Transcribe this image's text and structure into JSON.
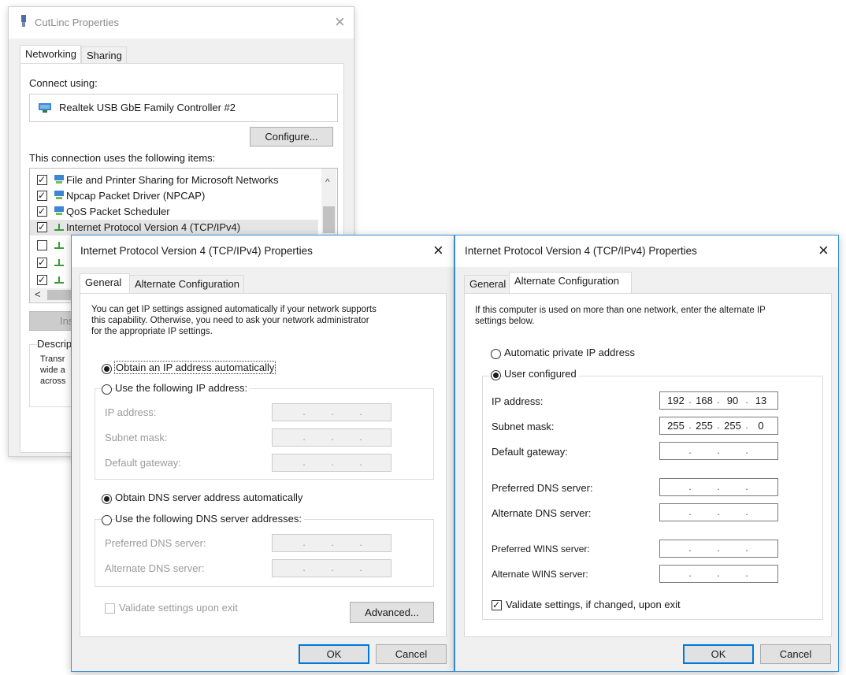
{
  "props": {
    "title": "CutLinc  Properties",
    "tabs": [
      "Networking",
      "Sharing"
    ],
    "connect_using_label": "Connect using:",
    "adapter": "Realtek USB GbE Family Controller #2",
    "configure_label": "Configure...",
    "items_label": "This connection uses the following items:",
    "items": [
      {
        "label": "File and Printer Sharing for Microsoft Networks",
        "checked": true,
        "icon": "network-service-icon"
      },
      {
        "label": "Npcap Packet Driver (NPCAP)",
        "checked": true,
        "icon": "network-service-icon"
      },
      {
        "label": "QoS Packet Scheduler",
        "checked": true,
        "icon": "network-service-icon"
      },
      {
        "label": "Internet Protocol Version 4 (TCP/IPv4)",
        "checked": true,
        "icon": "protocol-icon"
      },
      {
        "label": "",
        "checked": false,
        "icon": "protocol-icon"
      },
      {
        "label": "",
        "checked": true,
        "icon": "protocol-icon"
      },
      {
        "label": "",
        "checked": true,
        "icon": "protocol-icon"
      }
    ],
    "install_fragment": "Ins",
    "description_fragment": "Descrip",
    "desc_lines": [
      "Transr",
      "wide a",
      "across"
    ],
    "scroll_left_glyph": "<"
  },
  "general": {
    "title": "Internet Protocol Version 4 (TCP/IPv4) Properties",
    "tabs": [
      "General",
      "Alternate Configuration"
    ],
    "intro": [
      "You can get IP settings assigned automatically if your network supports",
      "this capability. Otherwise, you need to ask your network administrator",
      "for the appropriate IP settings."
    ],
    "obtain_ip": "Obtain an IP address automatically",
    "use_ip": "Use the following IP address:",
    "ip_label": "IP address:",
    "subnet_label": "Subnet mask:",
    "gateway_label": "Default gateway:",
    "obtain_dns": "Obtain DNS server address automatically",
    "use_dns": "Use the following DNS server addresses:",
    "pref_dns_label": "Preferred DNS server:",
    "alt_dns_label": "Alternate DNS server:",
    "validate_label": "Validate settings upon exit",
    "advanced_label": "Advanced...",
    "ok_label": "OK",
    "cancel_label": "Cancel",
    "obtain_ip_selected": true,
    "obtain_dns_selected": true,
    "validate_checked": false
  },
  "alternate": {
    "title": "Internet Protocol Version 4 (TCP/IPv4) Properties",
    "tabs": [
      "General",
      "Alternate Configuration"
    ],
    "intro": [
      "If this computer is used on more than one network, enter the alternate IP",
      "settings below."
    ],
    "auto_private": "Automatic private IP address",
    "user_configured": "User configured",
    "ip_label": "IP address:",
    "ip_value": [
      "192",
      "168",
      "90",
      "13"
    ],
    "subnet_label": "Subnet mask:",
    "subnet_value": [
      "255",
      "255",
      "255",
      "0"
    ],
    "gateway_label": "Default gateway:",
    "pref_dns_label": "Preferred DNS server:",
    "alt_dns_label": "Alternate DNS server:",
    "pref_wins_label": "Preferred WINS server:",
    "alt_wins_label": "Alternate WINS server:",
    "validate_label": "Validate settings, if changed, upon exit",
    "ok_label": "OK",
    "cancel_label": "Cancel",
    "user_configured_selected": true,
    "validate_checked": true
  },
  "icons": {
    "close": "×",
    "scroll_up": "^"
  }
}
